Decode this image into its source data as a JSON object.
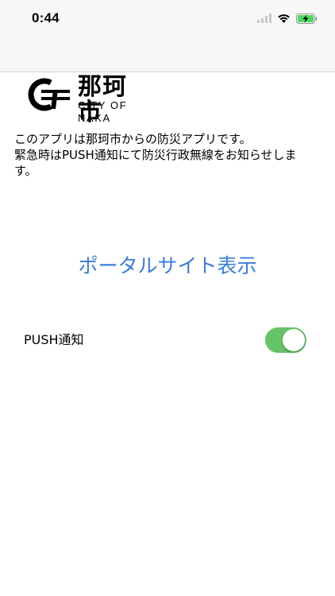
{
  "status_bar": {
    "time": "0:44",
    "icons": [
      "signal-icon",
      "wifi-icon",
      "battery-charging-icon"
    ]
  },
  "logo": {
    "kanji": "那珂市",
    "english": "CITY OF NAKA"
  },
  "description": {
    "line1": "このアプリは那珂市からの防災アプリです。",
    "line2": "緊急時はPUSH通知にて防災行政無線をお知らせします。"
  },
  "portal_link": {
    "label": "ポータルサイト表示"
  },
  "push_setting": {
    "label": "PUSH通知",
    "enabled": true
  },
  "colors": {
    "accent": "#3a7ddb",
    "toggle_on": "#65c466",
    "battery": "#4cd964"
  }
}
